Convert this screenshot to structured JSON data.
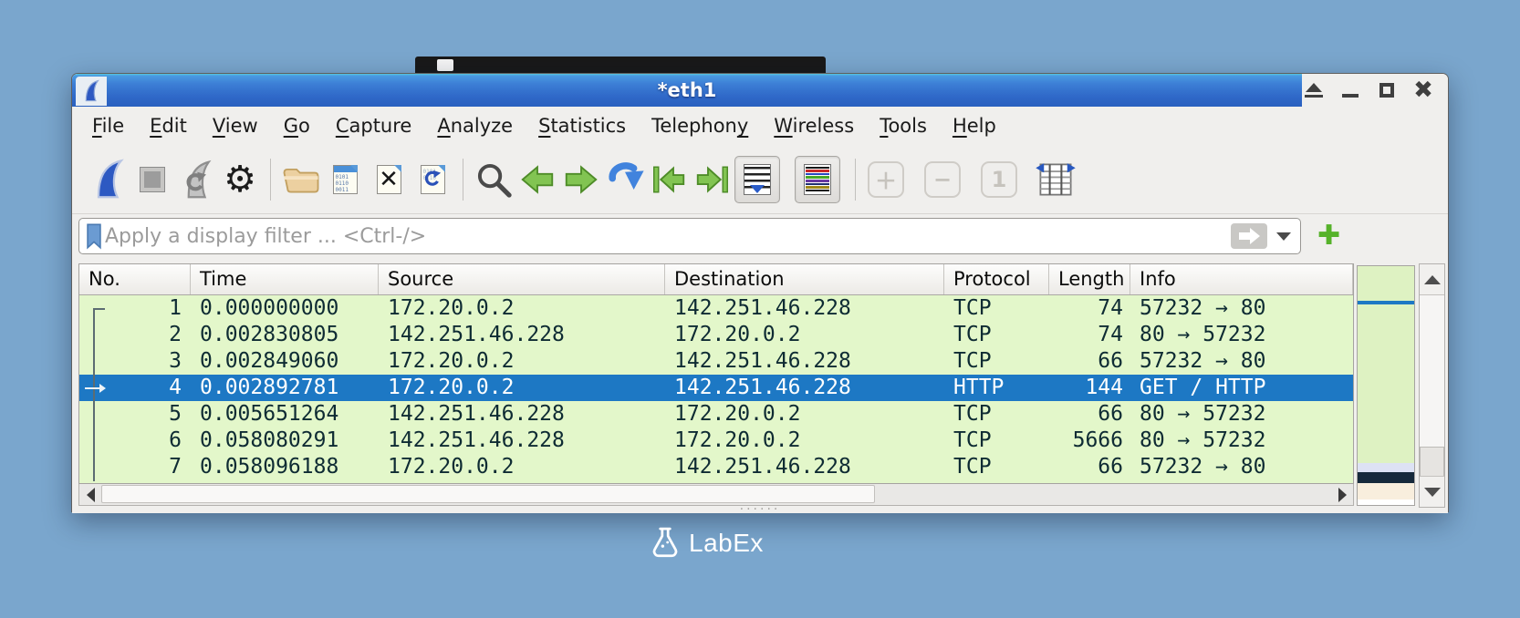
{
  "window": {
    "title": "*eth1",
    "controls": [
      "shade",
      "minimize",
      "maximize",
      "close"
    ]
  },
  "menu_bar": {
    "items": [
      {
        "label": "File",
        "mnemonic_index": 0
      },
      {
        "label": "Edit",
        "mnemonic_index": 0
      },
      {
        "label": "View",
        "mnemonic_index": 0
      },
      {
        "label": "Go",
        "mnemonic_index": 0
      },
      {
        "label": "Capture",
        "mnemonic_index": 0
      },
      {
        "label": "Analyze",
        "mnemonic_index": 0
      },
      {
        "label": "Statistics",
        "mnemonic_index": 0
      },
      {
        "label": "Telephony",
        "mnemonic_index": 8
      },
      {
        "label": "Wireless",
        "mnemonic_index": 0
      },
      {
        "label": "Tools",
        "mnemonic_index": 0
      },
      {
        "label": "Help",
        "mnemonic_index": 0
      }
    ]
  },
  "toolbar": {
    "buttons": [
      "start-capture",
      "stop-capture",
      "restart-capture",
      "capture-options",
      "open-file",
      "save-file",
      "close-file",
      "reload-file",
      "find-packet",
      "previous-packet",
      "next-packet",
      "go-to-packet",
      "first-packet",
      "last-packet",
      "auto-scroll",
      "colorize-packets",
      "zoom-in",
      "zoom-out",
      "zoom-100",
      "resize-columns"
    ],
    "zoom_100_label": "1",
    "colorize_bar_colors": [
      "#161616",
      "#c82828",
      "#2848c0",
      "#48a828",
      "#6838a0",
      "#203070",
      "#a08818",
      "#161616"
    ]
  },
  "filter_bar": {
    "placeholder": "Apply a display filter ... <Ctrl-/>"
  },
  "packet_list": {
    "columns": [
      "No.",
      "Time",
      "Source",
      "Destination",
      "Protocol",
      "Length",
      "Info"
    ],
    "selected_no": 4,
    "rows": [
      {
        "no": "1",
        "time": "0.000000000",
        "source": "172.20.0.2",
        "destination": "142.251.46.228",
        "protocol": "TCP",
        "length": "74",
        "info": "57232 → 80"
      },
      {
        "no": "2",
        "time": "0.002830805",
        "source": "142.251.46.228",
        "destination": "172.20.0.2",
        "protocol": "TCP",
        "length": "74",
        "info": "80 → 57232"
      },
      {
        "no": "3",
        "time": "0.002849060",
        "source": "172.20.0.2",
        "destination": "142.251.46.228",
        "protocol": "TCP",
        "length": "66",
        "info": "57232 → 80"
      },
      {
        "no": "4",
        "time": "0.002892781",
        "source": "172.20.0.2",
        "destination": "142.251.46.228",
        "protocol": "HTTP",
        "length": "144",
        "info": "GET / HTTP"
      },
      {
        "no": "5",
        "time": "0.005651264",
        "source": "142.251.46.228",
        "destination": "172.20.0.2",
        "protocol": "TCP",
        "length": "66",
        "info": "80 → 57232"
      },
      {
        "no": "6",
        "time": "0.058080291",
        "source": "142.251.46.228",
        "destination": "172.20.0.2",
        "protocol": "TCP",
        "length": "5666",
        "info": "80 → 57232"
      },
      {
        "no": "7",
        "time": "0.058096188",
        "source": "172.20.0.2",
        "destination": "142.251.46.228",
        "protocol": "TCP",
        "length": "66",
        "info": "57232 → 80"
      }
    ]
  },
  "colors": {
    "desktop": "#7aa6cd",
    "titlebar_blue": "#2f68c8",
    "row_green": "#e3f7ca",
    "selected_row_blue": "#1d78c4",
    "accent_green": "#56b22a"
  },
  "footer": {
    "brand": "LabEx"
  }
}
